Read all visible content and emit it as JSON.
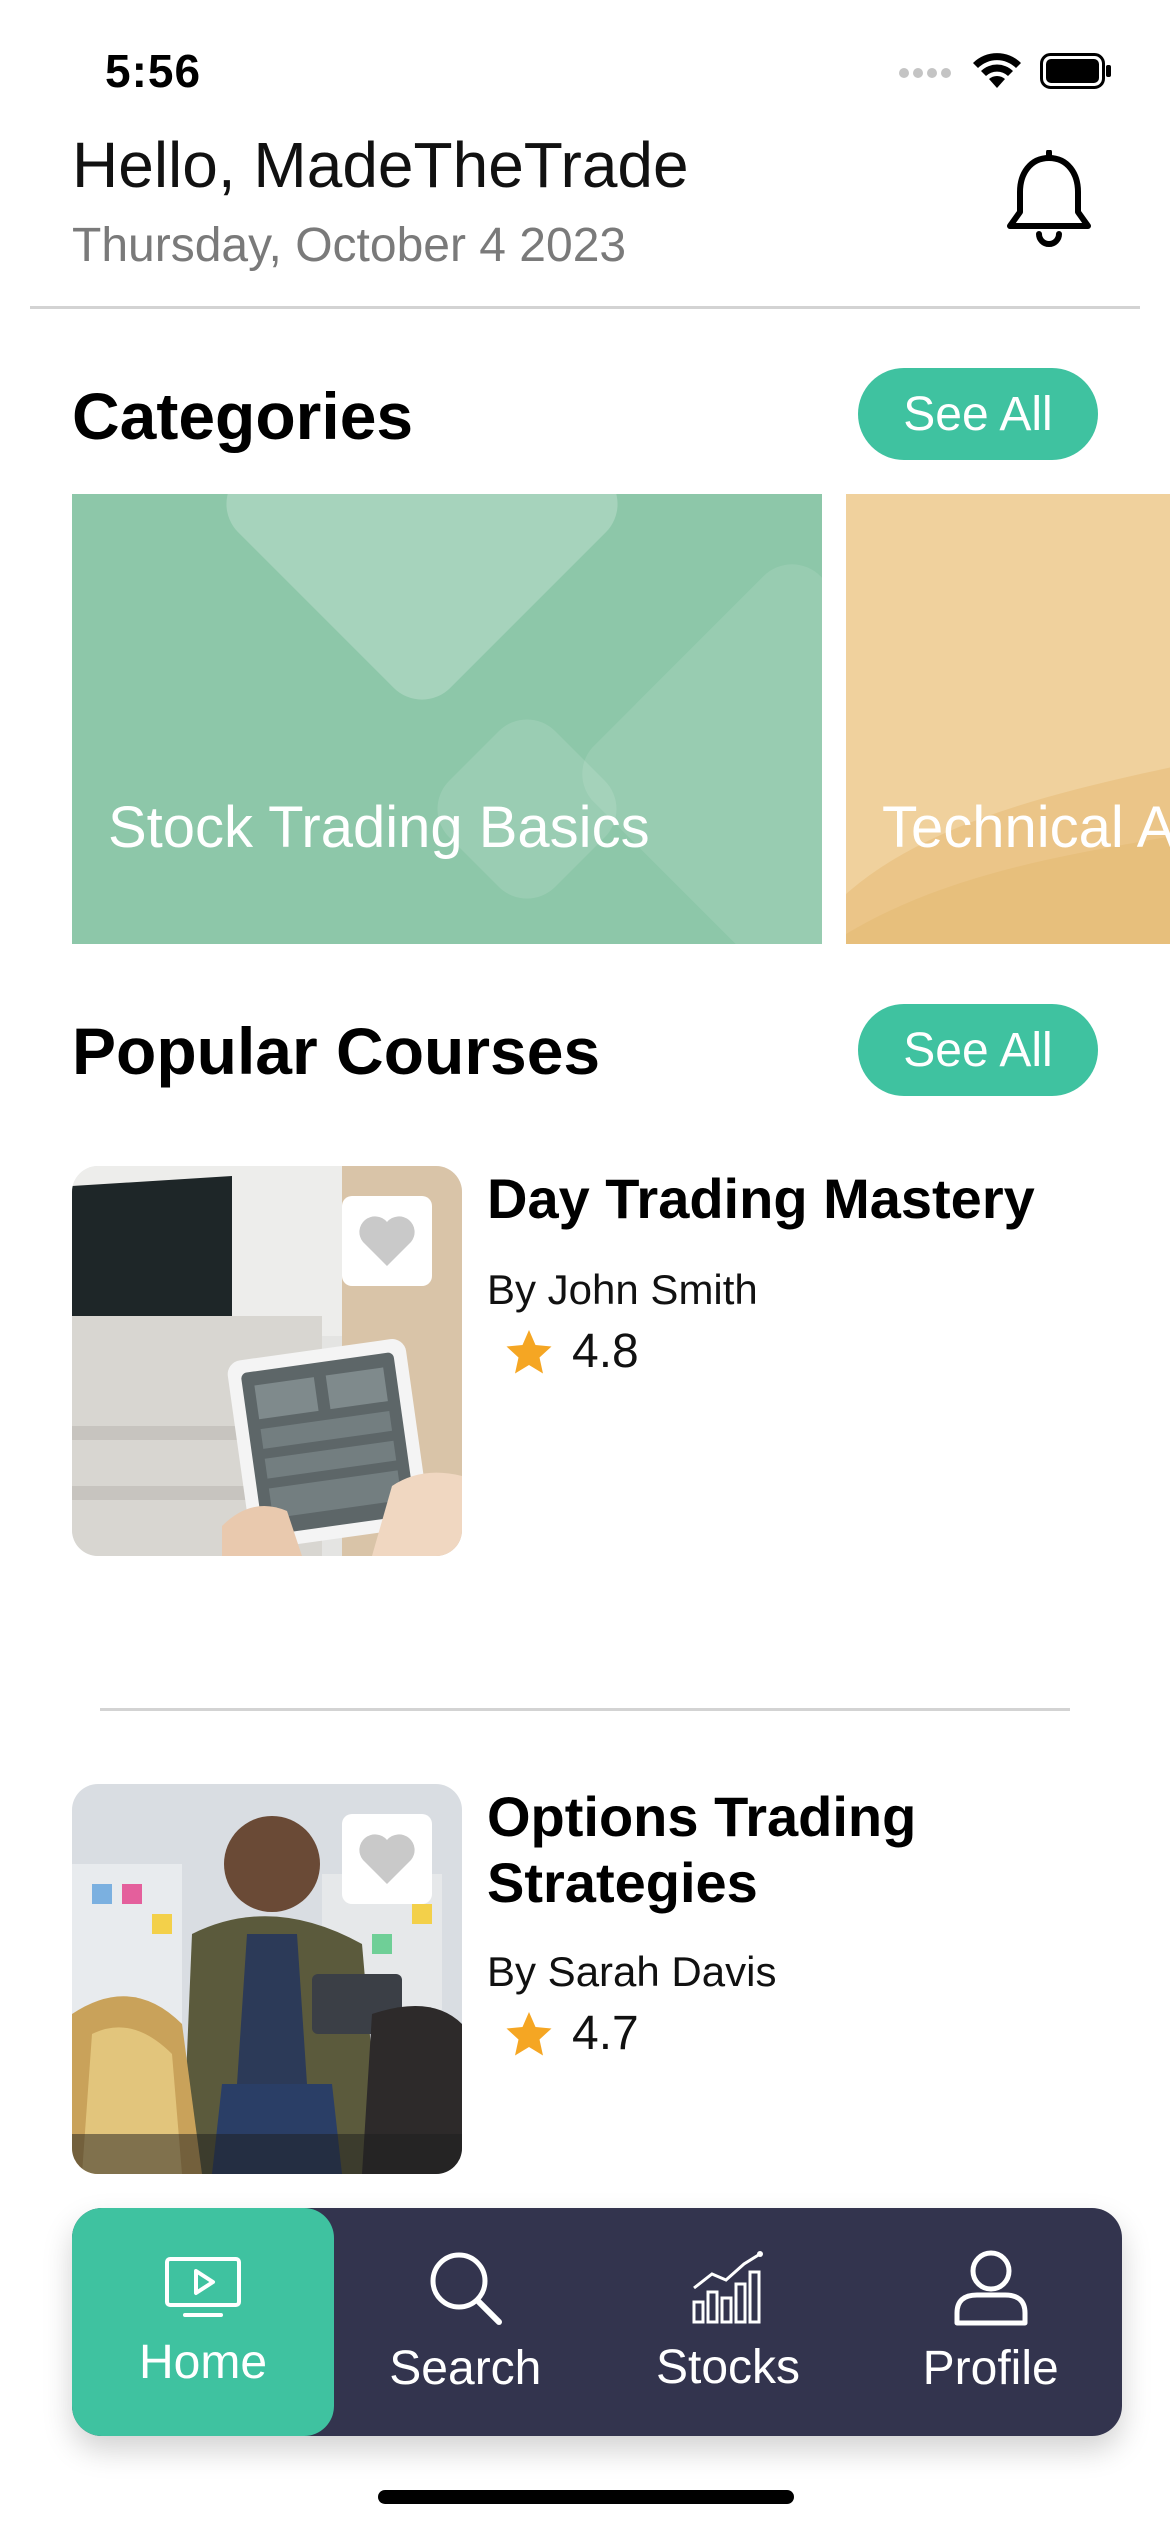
{
  "status_bar": {
    "time": "5:56"
  },
  "header": {
    "greeting": "Hello, MadeTheTrade",
    "date": "Thursday, October 4 2023"
  },
  "categories_section": {
    "title": "Categories",
    "see_all_label": "See All",
    "items": [
      {
        "label": "Stock Trading Basics",
        "color": "#8dc7a9"
      },
      {
        "label": "Technical A",
        "color": "#f0d19d"
      }
    ]
  },
  "courses_section": {
    "title": "Popular Courses",
    "see_all_label": "See All",
    "items": [
      {
        "title": "Day Trading Mastery",
        "author": "By John Smith",
        "rating": "4.8"
      },
      {
        "title": "Options Trading Strategies",
        "author": "By Sarah Davis",
        "rating": "4.7"
      }
    ]
  },
  "tab_bar": {
    "tabs": [
      {
        "label": "Home",
        "icon": "play-screen-icon",
        "active": true
      },
      {
        "label": "Search",
        "icon": "magnifier-icon",
        "active": false
      },
      {
        "label": "Stocks",
        "icon": "bar-chart-trend-icon",
        "active": false
      },
      {
        "label": "Profile",
        "icon": "person-icon",
        "active": false
      }
    ]
  },
  "colors": {
    "accent": "#3fc2a0",
    "tabbar_bg": "#33344e",
    "star": "#f5a623",
    "muted_text": "#7a7a7a"
  }
}
